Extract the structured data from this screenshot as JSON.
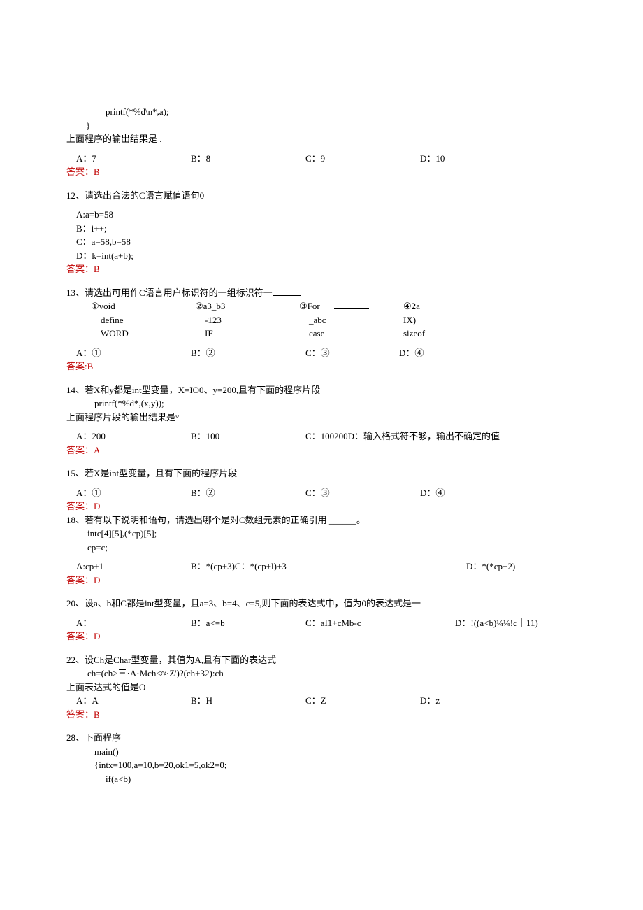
{
  "q11": {
    "code1": "printf(*%d\\n*,a);",
    "code2": "}",
    "stem": "上面程序的输出结果是             .",
    "a": "A：7",
    "b": "B：8",
    "c": "C：9",
    "d": "D：10",
    "ans": "答案：B"
  },
  "q12": {
    "stem": "12、请选出合法的C语言赋值语句0",
    "a": "Λ:a=b=58",
    "b": "B：i++;",
    "c": "C：a=58,b=58",
    "d": "D：k=int(a+b);",
    "ans": "答案：B"
  },
  "q13": {
    "stem": "13、请选出可用作C语言用户标识符的一组标识符一",
    "t": {
      "r1c1": "①void",
      "r1c2": "②a3_b3",
      "r1c3": "③For",
      "r1c4": "④2a",
      "r2c1": "define",
      "r2c2": "-123",
      "r2c3": "_abc",
      "r2c4": "IX)",
      "r3c1": "WORD",
      "r3c2": "IF",
      "r3c3": "case",
      "r3c4": "sizeof"
    },
    "a": "A：①",
    "b": "B：②",
    "c": "C：③",
    "d": "D：④",
    "ans": "答案:B"
  },
  "q14": {
    "stem1": "14、若X和y都是int型变量，X=IO0、y=200,且有下面的程序片段",
    "code": "printf(*%d*,(x,y));",
    "stem2": "上面程序片段的输出结果是°",
    "a": "A：200",
    "b": "B：100",
    "c": "C：100200D：输入格式符不够，输出不确定的值",
    "ans": "答案：A"
  },
  "q15": {
    "stem": "15、若X是int型变量，且有下面的程序片段",
    "a": "A：①",
    "b": "B：②",
    "c": "C：③",
    "d": "D：④",
    "ans": "答案：D"
  },
  "q18": {
    "stem": "18、若有以下说明和语句，请选出哪个是对C数组元素的正确引用 ______。",
    "code1": "intc[4][5],(*cp)[5];",
    "code2": "cp=c;",
    "a": "Λ:cp+1",
    "b": "B：*(cp+3)C：*(cp+l)+3",
    "d": "D：*(*cp+2)",
    "ans": "答案：D"
  },
  "q20": {
    "stem": "20、设a、b和C都是int型变量，且a=3、b=4、c=5,则下面的表达式中，值为0的表达式是一",
    "a": "A：",
    "b": "B：a<=b",
    "c": "C：aI1+cMb-c",
    "d": "D：!((a<b)¼¼!c｜11)",
    "ans": "答案：D"
  },
  "q22": {
    "stem1": "22、设Ch是Char型变量，其值为A,且有下面的表达式",
    "code": "ch=(ch>三·A·Mch<≈·Z')?(ch+32):ch",
    "stem2": "上面表达式的值是O",
    "a": "A：A",
    "b": "B：H",
    "c": "C：Z",
    "d": "D：z",
    "ans": "答案：B"
  },
  "q28": {
    "stem": "28、下面程序",
    "code1": "main()",
    "code2": "{intx=100,a=10,b=20,ok1=5,ok2=0;",
    "code3": "if(a<b)"
  }
}
